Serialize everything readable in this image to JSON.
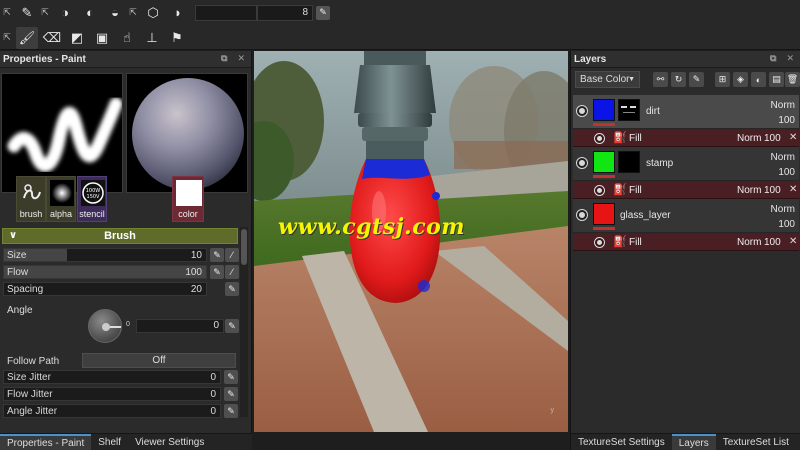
{
  "toolbar": {
    "size_value": "8"
  },
  "left_panel": {
    "title": "Properties - Paint",
    "slots": [
      {
        "label": "brush"
      },
      {
        "label": "alpha"
      },
      {
        "label": "stencil"
      },
      {
        "label": "color"
      }
    ],
    "section_title": "Brush",
    "size": {
      "label": "Size",
      "value": "10",
      "level": 0.31
    },
    "flow": {
      "label": "Flow",
      "value": "100",
      "level": 1.0
    },
    "spacing": {
      "label": "Spacing",
      "value": "20",
      "level": 0.0
    },
    "angle": {
      "label": "Angle",
      "value": "0",
      "dial_zero": "0"
    },
    "follow_path": {
      "label": "Follow Path",
      "value": "Off"
    },
    "jitters": [
      {
        "label": "Size Jitter",
        "value": "0"
      },
      {
        "label": "Flow Jitter",
        "value": "0"
      },
      {
        "label": "Angle Jitter",
        "value": "0"
      }
    ],
    "tabs": [
      {
        "label": "Properties - Paint",
        "active": true
      },
      {
        "label": "Shelf",
        "active": false
      },
      {
        "label": "Viewer Settings",
        "active": false
      }
    ]
  },
  "viewport": {
    "watermark": "www.cgtsj.com",
    "axis_label": "y"
  },
  "right_panel": {
    "title": "Layers",
    "channel": "Base Color",
    "layers": [
      {
        "name": "dirt",
        "blend": "Norm",
        "opacity": "100",
        "color": "#0a14e6",
        "selected": true,
        "fill": {
          "name": "Fill",
          "blend": "Norm",
          "opacity": "100"
        }
      },
      {
        "name": "stamp",
        "blend": "Norm",
        "opacity": "100",
        "color": "#12e612",
        "selected": false,
        "fill": {
          "name": "Fill",
          "blend": "Norm",
          "opacity": "100"
        }
      },
      {
        "name": "glass_layer",
        "blend": "Norm",
        "opacity": "100",
        "color": "#e61414",
        "selected": false,
        "fill": {
          "name": "Fill",
          "blend": "Norm",
          "opacity": "100"
        }
      }
    ],
    "tabs": [
      {
        "label": "TextureSet Settings",
        "active": false
      },
      {
        "label": "Layers",
        "active": true
      },
      {
        "label": "TextureSet List",
        "active": false
      }
    ]
  },
  "colors": {
    "accent_tab": "#4c92c9",
    "section_green": "#5f6b2a",
    "fill_row": "#4a1f24"
  }
}
